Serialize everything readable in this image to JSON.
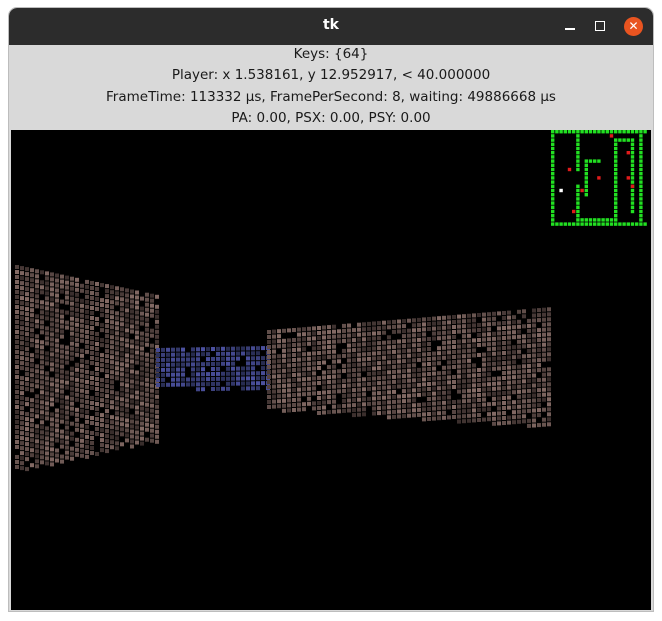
{
  "window": {
    "title": "tk",
    "minimize": "minimize",
    "maximize": "maximize",
    "close": "close"
  },
  "hud": {
    "keys": "Keys: {64}",
    "player": "Player: x 1.538161, y 12.952917, < 40.000000",
    "frame": "FrameTime: 113332 µs, FramePerSecond: 8, waiting: 49886668 µs",
    "pa": "PA: 0.00, PSX: 0.00, PSY: 0.00"
  },
  "colors": {
    "minimap_wall": "#22e022",
    "minimap_enemy": "#e01b1b",
    "minimap_player": "#ffffff",
    "wall_tint": "#6b5a55",
    "far_wall_tint": "#5a5a9a"
  }
}
